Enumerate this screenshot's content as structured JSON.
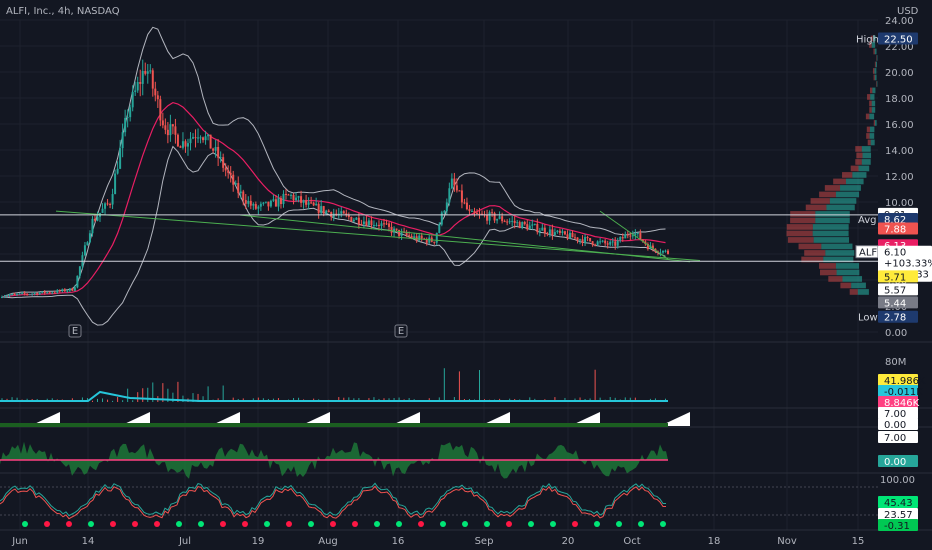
{
  "header": {
    "symbol": "ALFI, Inc., 4h, NASDAQ",
    "currency": "USD"
  },
  "colors": {
    "background": "#131722",
    "grid": "#1e222d",
    "up": "#26a69a",
    "down": "#ef5350",
    "bb": "#b2b5be",
    "basis": "#e91e63",
    "trend": "#4caf50",
    "axis_text": "#b2b5be",
    "volume": "#26c6da",
    "yellow": "#ffeb3b",
    "pink": "#ff4081",
    "green_dot": "#00e676",
    "red_dot": "#ff1744"
  },
  "chart_data": [
    {
      "type": "candlestick",
      "name": "price",
      "x_ticks": [
        "Jun",
        "14",
        "Jul",
        "19",
        "Aug",
        "16",
        "Sep",
        "20",
        "Oct",
        "18",
        "Nov",
        "15"
      ],
      "y_ticks": [
        "24.00",
        "22.00",
        "20.00",
        "18.00",
        "16.00",
        "14.00",
        "12.00",
        "10.00",
        "8.00",
        "6.00",
        "4.00",
        "2.00",
        "0.00"
      ],
      "ylim": [
        0,
        24
      ],
      "earnings_markers": [
        "E",
        "E"
      ],
      "labels": [
        {
          "text": "High",
          "value": "22.50"
        },
        {
          "text": "",
          "value": "9.01"
        },
        {
          "text": "Avg",
          "value": "8.62"
        },
        {
          "text": "",
          "value": "7.88"
        },
        {
          "text": "",
          "value": "6.13"
        },
        {
          "text": "ALF",
          "value": "6.10",
          "change": "+103.33%",
          "countdown": "03:16:33"
        },
        {
          "text": "",
          "value": "5.71"
        },
        {
          "text": "",
          "value": "5.57"
        },
        {
          "text": "",
          "value": "5.44"
        },
        {
          "text": "Low",
          "value": "2.78"
        }
      ],
      "horizontal_lines": [
        9.01,
        5.44
      ],
      "close_approx": [
        2.8,
        2.9,
        3.0,
        3.1,
        3.3,
        8.5,
        10.0,
        17.0,
        20.5,
        16.0,
        14.5,
        15.5,
        13.5,
        11.0,
        9.5,
        9.8,
        10.5,
        9.7,
        9.3,
        8.9,
        8.6,
        8.3,
        7.6,
        7.2,
        7.0,
        11.5,
        9.0,
        8.9,
        8.6,
        8.2,
        7.9,
        7.5,
        7.2,
        6.9,
        6.7,
        7.8,
        6.5,
        6.1
      ]
    },
    {
      "type": "bar",
      "name": "volume",
      "y_ticks": [
        "80M"
      ],
      "labels": [
        "41.986K",
        "-0.011K",
        "8.846K"
      ]
    },
    {
      "type": "area",
      "name": "indicator_1",
      "labels": [
        "7.00",
        "0.00"
      ]
    },
    {
      "type": "area",
      "name": "indicator_2",
      "labels": [
        "7.00",
        "0.00"
      ]
    },
    {
      "type": "line",
      "name": "stochastic",
      "y_ticks": [
        "100.00"
      ],
      "labels": [
        "45.43",
        "23.57",
        "-0.31"
      ]
    }
  ]
}
